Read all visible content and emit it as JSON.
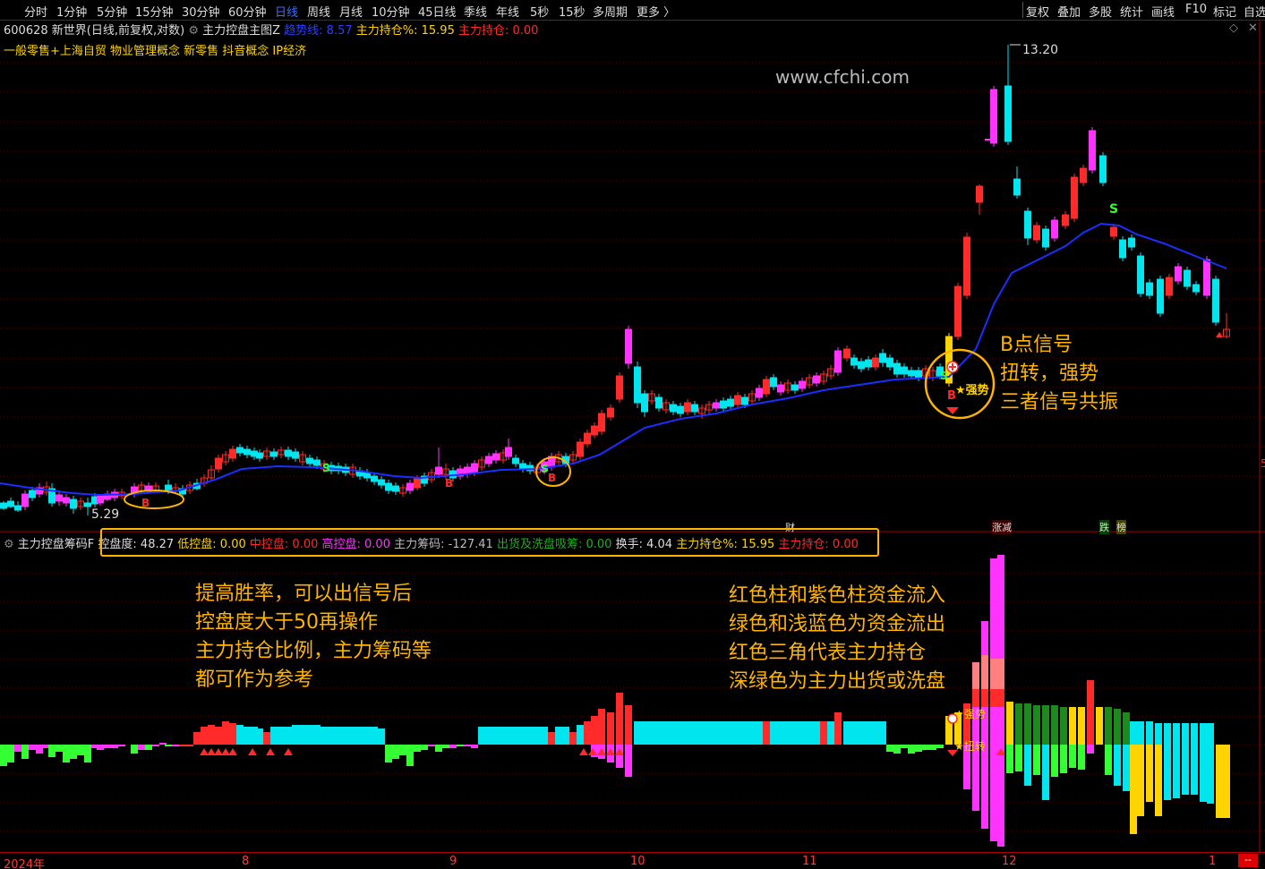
{
  "toolbar": {
    "tabs": [
      "分时",
      "1分钟",
      "5分钟",
      "15分钟",
      "30分钟",
      "60分钟",
      "日线",
      "周线",
      "月线",
      "10分钟",
      "45日线",
      "季线",
      "年线",
      "5秒",
      "15秒",
      "多周期",
      "更多 〉"
    ],
    "active": "日线",
    "right_tools": [
      "复权",
      "叠加",
      "多股",
      "统计",
      "画线",
      "F10",
      "标记",
      "自选"
    ]
  },
  "header": {
    "code_name": "600628 新世界(日线,前复权,对数)",
    "indicator_name": "主力控盘主图Z",
    "ma_label": "趋势线: 8.57",
    "hold_pct": "主力持仓%: 15.95",
    "hold_qty": "主力持仓: 0.00"
  },
  "concepts": "一般零售+上海自贸 物业管理概念 新零售 抖音概念 IP经济",
  "watermark": "www.cfchi.com",
  "price_labels": {
    "high": "13.20",
    "low": "5.29"
  },
  "chart_marks": {
    "strong": "★强势",
    "twist": "★扭转",
    "strong_lower": "★强势",
    "twist_lower": "★扭转",
    "buy": "B",
    "sell": "S",
    "cai": "财",
    "zhang": "涨减",
    "die": "跌",
    "bang": "榜",
    "right_edge": "5"
  },
  "indicator": {
    "name": "主力控盘筹码F",
    "kongpan": "控盘度: 48.27",
    "low": "低控盘: 0.00",
    "mid": "中控盘: 0.00",
    "high": "高控盘: 0.00",
    "chip": "主力筹码: -127.41",
    "out": "出货及洗盘吸筹: 0.00",
    "turnover": "换手: 4.04",
    "hold_pct": "主力持仓%: 15.95",
    "hold_qty": "主力持仓: 0.00"
  },
  "annotations": {
    "b_signal": [
      "B点信号",
      "扭转，强势",
      "三者信号共振"
    ],
    "left": [
      "提高胜率，可以出信号后",
      "控盘度大于50再操作",
      "主力持仓比例，主力筹码等",
      "都可作为参考"
    ],
    "right": [
      "红色柱和紫色柱资金流入",
      "绿色和浅蓝色为资金流出",
      "红色三角代表主力持仓",
      "深绿色为主力出货或洗盘"
    ]
  },
  "dates": [
    "2024年",
    "8",
    "9",
    "10",
    "11",
    "12",
    "1"
  ],
  "colors": {
    "up": "#ff2a2a",
    "down": "#00e5ee",
    "magenta": "#ff33ff",
    "ma": "#1a2fff",
    "yellow": "#ffd400",
    "green": "#33ff33",
    "orange": "#ffb400"
  }
}
